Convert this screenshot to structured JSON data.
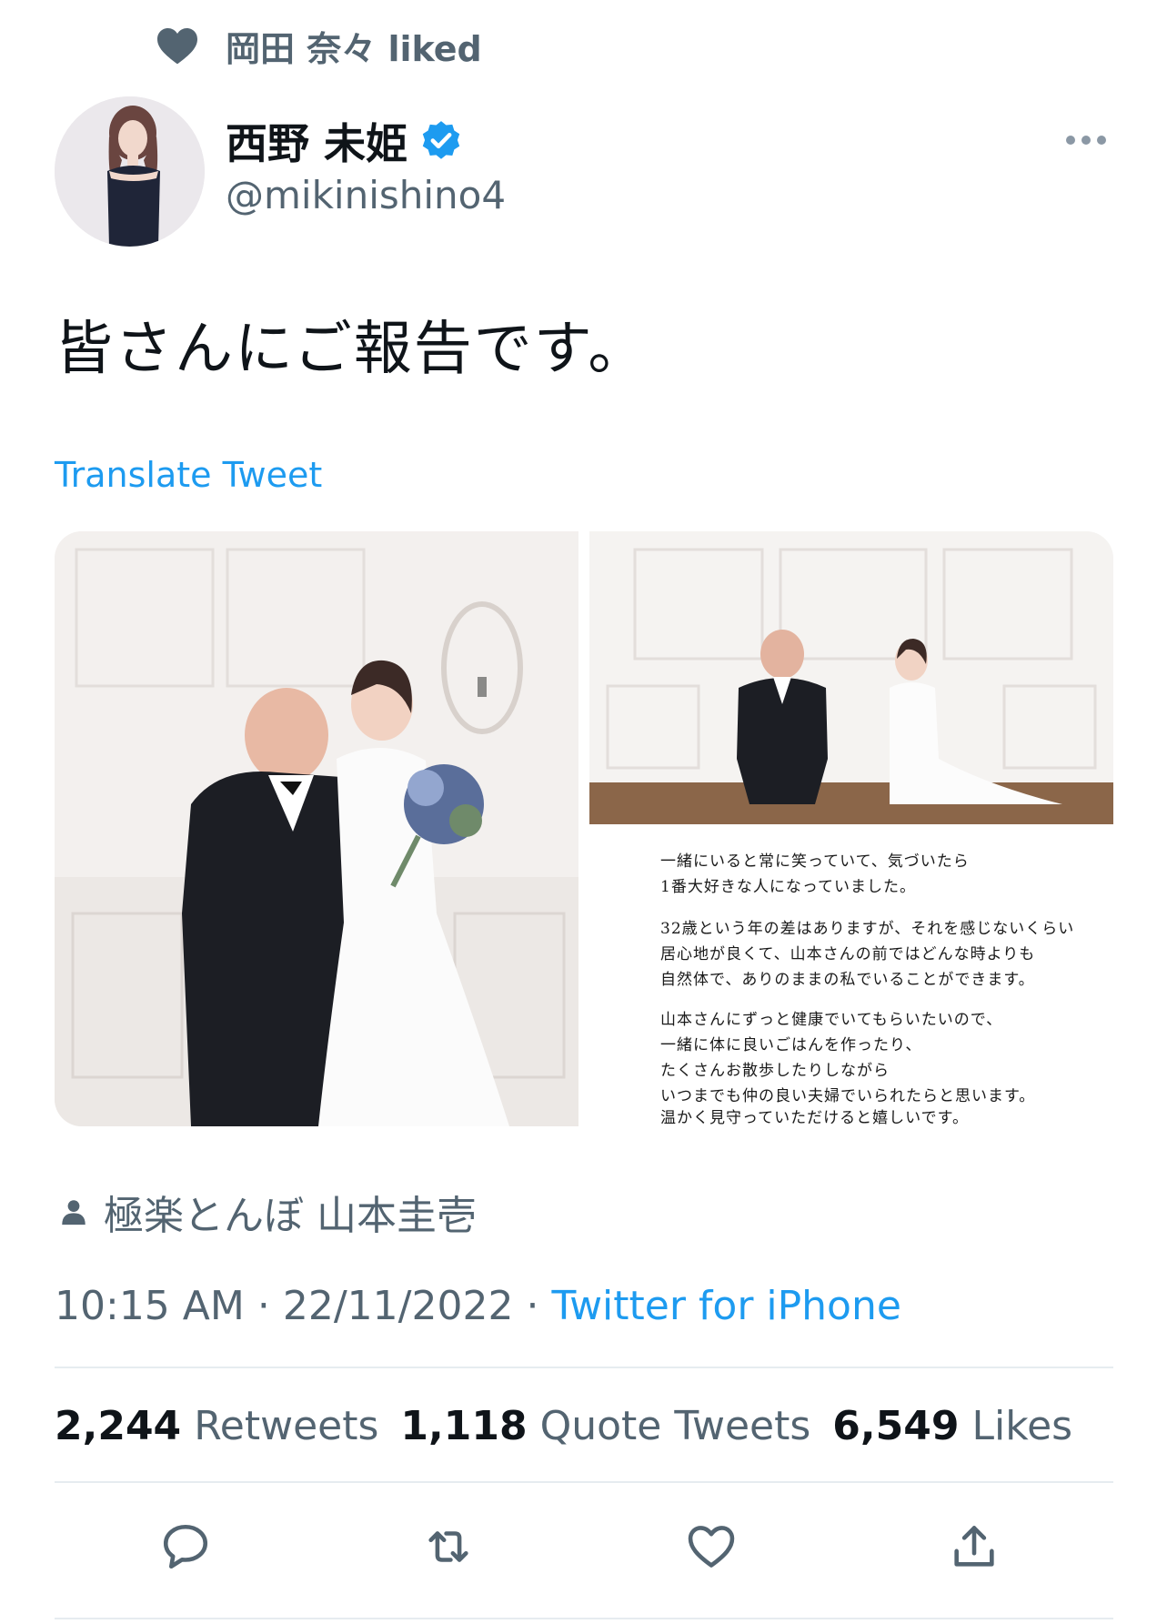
{
  "social_context": {
    "text": "岡田 奈々 liked",
    "icon": "heart-icon"
  },
  "author": {
    "display_name": "西野 未姫",
    "handle": "@mikinishino4",
    "verified": true,
    "verified_icon": "verified-badge-icon"
  },
  "tweet": {
    "text": "皆さんにご報告です。",
    "translate_label": "Translate Tweet",
    "letter_lines": [
      "一緒にいると常に笑っていて、気づいたら",
      "1番大好きな人になっていました。",
      "32歳という年の差はありますが、それを感じないくらい",
      "居心地が良くて、山本さんの前ではどんな時よりも",
      "自然体で、ありのままの私でいることができます。",
      "山本さんにずっと健康でいてもらいたいので、",
      "一緒に体に良いごはんを作ったり、",
      "たくさんお散歩したりしながら",
      "いつまでも仲の良い夫婦でいられたらと思います。",
      "温かく見守っていただけると嬉しいです。"
    ],
    "tagged_user": "極楽とんぼ 山本圭壱",
    "time": "10:15 AM",
    "date": "22/11/2022",
    "separator": "·",
    "source": "Twitter for iPhone"
  },
  "stats": {
    "retweets_count": "2,244",
    "retweets_label": "Retweets",
    "quotes_count": "1,118",
    "quotes_label": "Quote Tweets",
    "likes_count": "6,549",
    "likes_label": "Likes"
  },
  "actions": [
    "reply-icon",
    "retweet-icon",
    "like-icon",
    "share-icon"
  ],
  "colors": {
    "accent": "#1d9bf0",
    "secondary_text": "#536471",
    "primary_text": "#0f1419"
  }
}
